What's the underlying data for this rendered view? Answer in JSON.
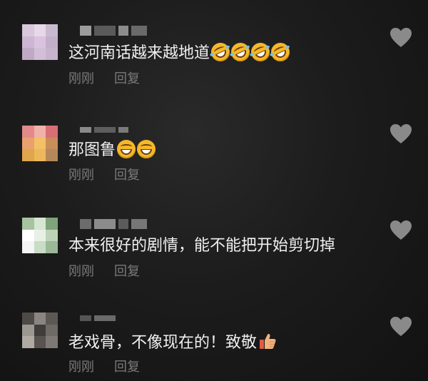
{
  "comments": [
    {
      "text": "这河南话越来越地道",
      "emojis": [
        "rofl-emoji",
        "rofl-emoji",
        "rofl-emoji",
        "rofl-emoji"
      ],
      "time": "刚刚",
      "reply_label": "回复",
      "avatar_colors": [
        "#d8c7da",
        "#e6d8e8",
        "#c9b9d0",
        "#cdb6d3",
        "#d9c3df",
        "#c4afca",
        "#bfa9c4",
        "#d2bfd6",
        "#c8b3cd"
      ],
      "name_colors": [
        "#9c9c9c",
        "#5a5a5a",
        "#8c8c8c",
        "#6a6a6a"
      ]
    },
    {
      "text": "那图鲁",
      "emojis": [
        "grin-emoji",
        "grin-emoji"
      ],
      "time": "刚刚",
      "reply_label": "回复",
      "avatar_colors": [
        "#e28a8a",
        "#f0b1a8",
        "#d96e74",
        "#e9a06f",
        "#f3c066",
        "#c98d5a",
        "#e0a64c",
        "#eeb75c",
        "#b4885a"
      ],
      "name_colors": [
        "#8a8a8a",
        "#5e5e5e",
        "#7a7a7a"
      ]
    },
    {
      "text": "本来很好的剧情，能不能把开始剪切掉",
      "emojis": [],
      "time": "刚刚",
      "reply_label": "回复",
      "avatar_colors": [
        "#a7c3a1",
        "#d5e6d1",
        "#7fa37b",
        "#ffffff",
        "#e8f0e5",
        "#bcd3b7",
        "#f5f5f5",
        "#c9dcc5",
        "#9bb897"
      ],
      "name_colors": [
        "#6c6c6c",
        "#8c8c8c",
        "#5b5b5b",
        "#777777"
      ]
    },
    {
      "text": "老戏骨，不像现在的！致敬",
      "emojis": [
        "thumbs-up-emoji"
      ],
      "time": "刚刚",
      "reply_label": "回复",
      "avatar_colors": [
        "#4d4a48",
        "#8a8580",
        "#5c5955",
        "#9d9791",
        "#3f3c3a",
        "#6e6a66",
        "#b0aaa3",
        "#575350",
        "#7e7974"
      ],
      "name_colors": [
        "#555555",
        "#6a6a6a"
      ]
    }
  ]
}
